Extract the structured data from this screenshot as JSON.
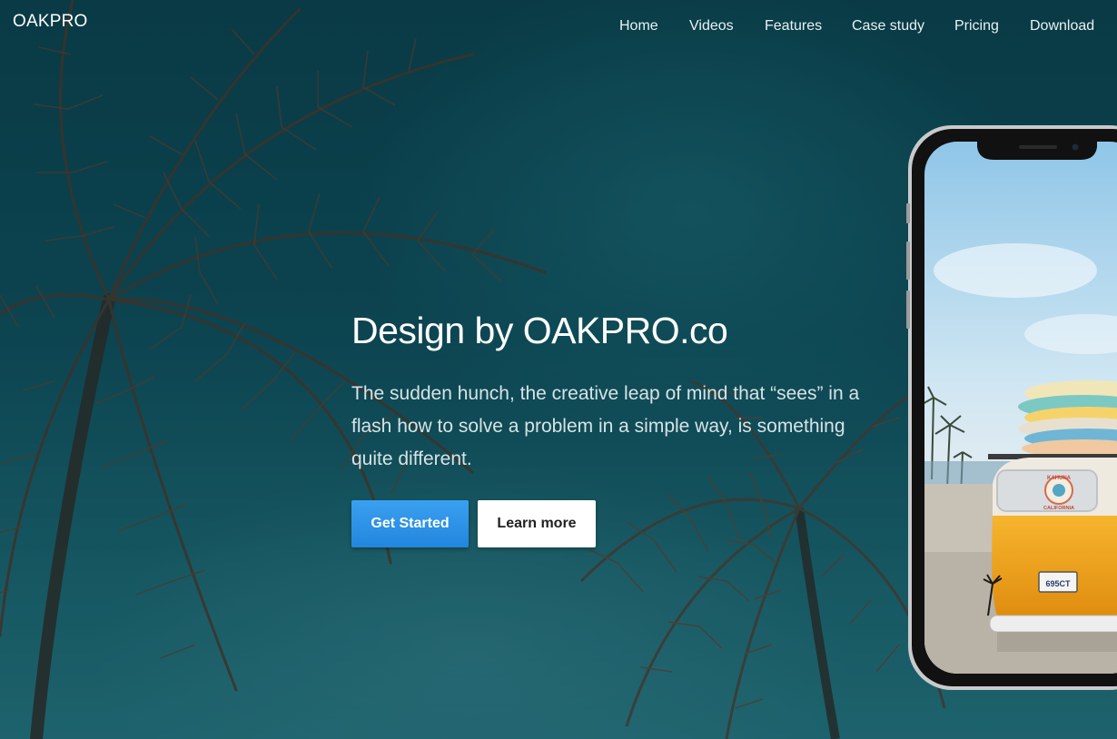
{
  "brand": {
    "logo_text": "OAKPRO"
  },
  "nav": {
    "items": [
      {
        "label": "Home"
      },
      {
        "label": "Videos"
      },
      {
        "label": "Features"
      },
      {
        "label": "Case study"
      },
      {
        "label": "Pricing"
      },
      {
        "label": "Download"
      }
    ]
  },
  "hero": {
    "headline": "Design by OAKPRO.co",
    "subtext": "The sudden hunch, the creative leap of mind that “sees” in a flash how to solve a problem in a simple way, is something quite different.",
    "primary_button": "Get Started",
    "secondary_button": "Learn more"
  },
  "phone_screen": {
    "license_plate": "695CT",
    "sticker_line1": "KAHUNA",
    "sticker_line2": "CALIFORNIA"
  },
  "colors": {
    "background": "#0d4550",
    "primary_button": "#2b8fe6",
    "van_orange": "#f2a019",
    "phone_frame": "#111111"
  }
}
